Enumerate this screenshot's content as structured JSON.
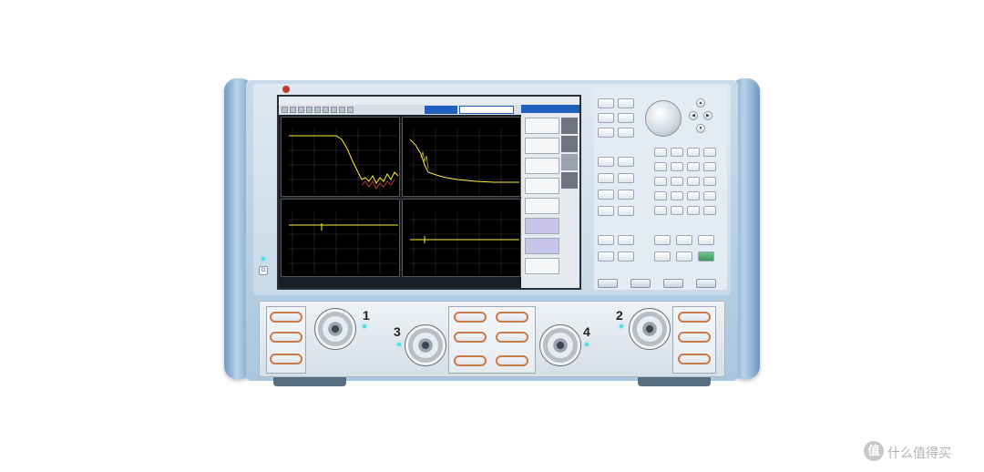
{
  "brand": {
    "logo_text": "",
    "model_line": ""
  },
  "screen": {
    "menu": [
      "",
      "",
      "",
      "",
      "",
      ""
    ],
    "input_box": {
      "left": "",
      "right": ""
    },
    "plots": [
      {
        "label": ""
      },
      {
        "label": ""
      },
      {
        "label": ""
      },
      {
        "label": ""
      }
    ],
    "softkeys": {
      "title": "",
      "keys": [
        "",
        "",
        "",
        "",
        "",
        "",
        "",
        ""
      ]
    }
  },
  "ports": [
    "1",
    "2",
    "3",
    "4"
  ],
  "watermark": {
    "text": "什么值得买",
    "icon": "值"
  },
  "colors": {
    "chassis": "#aac6de",
    "handle": "#6f9bc4",
    "screen_bg": "#000000",
    "trace": "#ffef40",
    "softkey_bar": "#1f5fbf",
    "cable": "#c77b4a",
    "led": "#4ddce0"
  }
}
